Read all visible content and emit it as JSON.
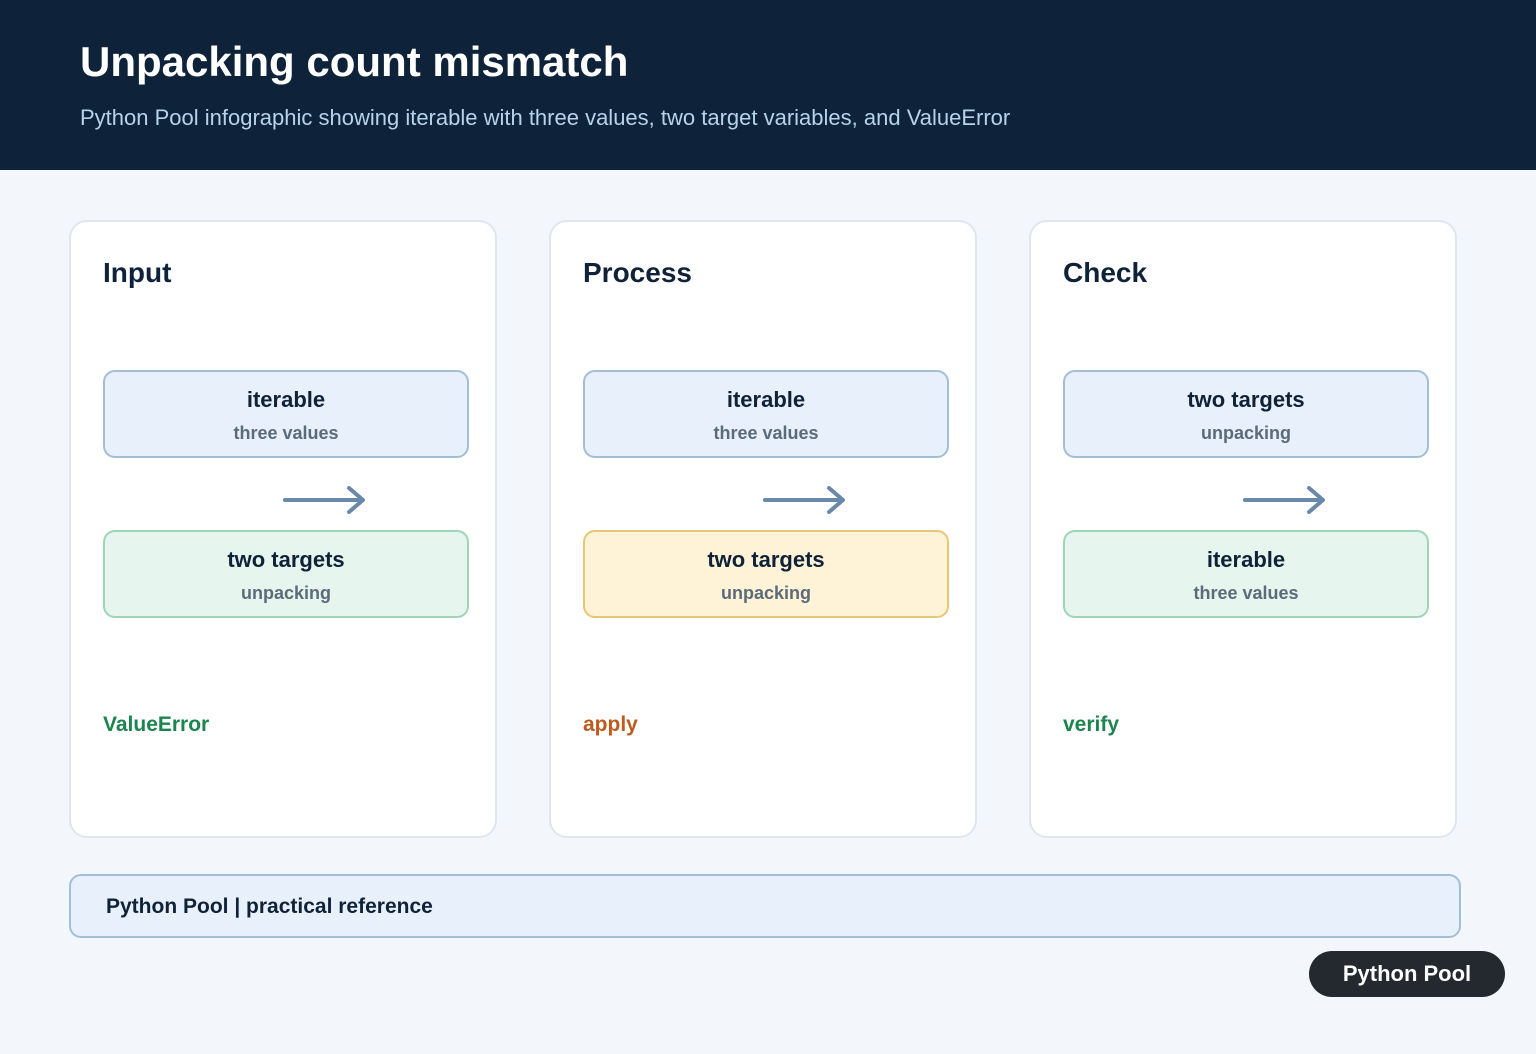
{
  "header": {
    "title": "Unpacking count mismatch",
    "subtitle": "Python Pool infographic showing iterable with three values, two target variables, and ValueError"
  },
  "panels": [
    {
      "title": "Input",
      "top_box": {
        "title": "iterable",
        "subtitle": "three values"
      },
      "bottom_box": {
        "title": "two targets",
        "subtitle": "unpacking"
      },
      "status": "ValueError"
    },
    {
      "title": "Process",
      "top_box": {
        "title": "iterable",
        "subtitle": "three values"
      },
      "bottom_box": {
        "title": "two targets",
        "subtitle": "unpacking"
      },
      "status": "apply"
    },
    {
      "title": "Check",
      "top_box": {
        "title": "two targets",
        "subtitle": "unpacking"
      },
      "bottom_box": {
        "title": "iterable",
        "subtitle": "three values"
      },
      "status": "verify"
    }
  ],
  "footer": {
    "text": "Python Pool | practical reference"
  },
  "brand": {
    "label": "Python Pool"
  },
  "colors": {
    "header_bg": "#0e233a",
    "blue_box": "#e8f0fb",
    "green_box": "#e6f5ee",
    "yellow_box": "#fef3d7",
    "status_green": "#1d8450",
    "status_orange": "#bf5a1d",
    "arrow": "#6a88a8"
  },
  "icons": {
    "arrow": "arrow-right-icon"
  }
}
